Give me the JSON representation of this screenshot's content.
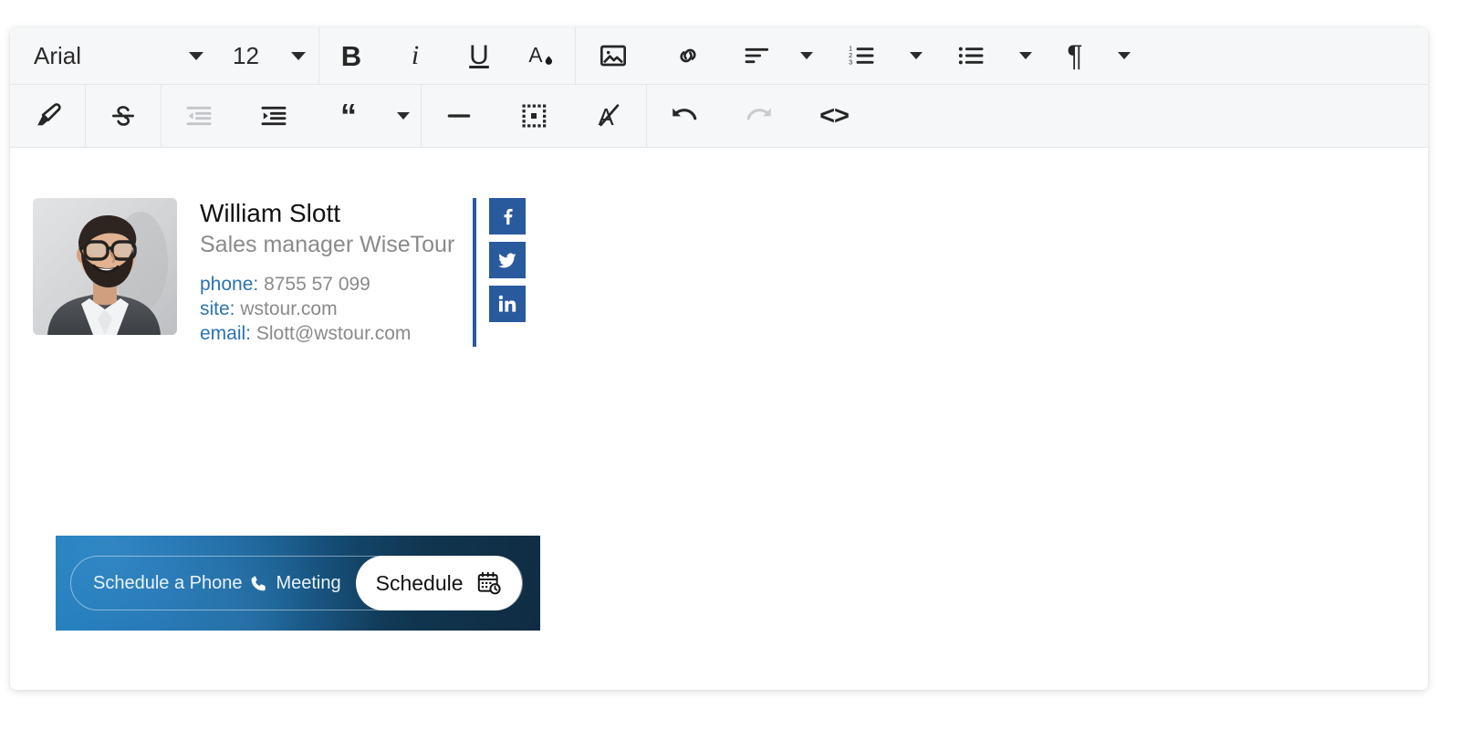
{
  "editor": {
    "toolbar": {
      "font_family": "Arial",
      "font_size": "12",
      "groups": [
        {
          "name": "font",
          "items": [
            {
              "label": "Arial",
              "icon": "font-family-select"
            },
            {
              "label": "12",
              "icon": "font-size-select"
            }
          ]
        }
      ],
      "buttons": {
        "bold": "B",
        "italic": "i",
        "underline": "U",
        "font_color": "A",
        "insert_image": "image-icon",
        "insert_link": "link-icon",
        "align": "align-left-icon",
        "ordered_list": "ordered-list-icon",
        "unordered_list": "unordered-list-icon",
        "paragraph": "¶",
        "highlight": "marker-icon",
        "strikethrough": "S",
        "outdent": "decrease-indent-icon",
        "indent": "increase-indent-icon",
        "blockquote": "“",
        "horizontal_rule": "horizontal-rule-icon",
        "table": "table-icon",
        "clear_format": "clear-format-icon",
        "undo": "undo-icon",
        "redo": "redo-icon",
        "source_code": "<>"
      }
    },
    "signature": {
      "name": "William Slott",
      "role": "Sales manager WiseTour",
      "contacts": [
        {
          "label": "phone:",
          "value": "8755 57 099"
        },
        {
          "label": "site:",
          "value": "wstour.com"
        },
        {
          "label": "email:",
          "value": "Slott@wstour.com"
        }
      ],
      "social": [
        {
          "name": "facebook",
          "glyph": "f"
        },
        {
          "name": "twitter",
          "glyph": "twitter-bird"
        },
        {
          "name": "linkedin",
          "glyph": "in"
        }
      ],
      "avatar_alt": "Portrait of bearded man with glasses in gray suit",
      "banner": {
        "text_before": "Schedule a Phone",
        "text_after": "Meeting",
        "phone_icon": "phone-icon",
        "cta_label": "Schedule",
        "cta_icon": "calendar-clock-icon"
      }
    }
  },
  "colors": {
    "accent_blue": "#2b72b0",
    "social_blue": "#2a5a9e",
    "banner_from": "#1877b8",
    "banner_to": "#0f2c42",
    "toolbar_bg": "#f6f7f8",
    "muted_text": "#8a8a8a"
  }
}
